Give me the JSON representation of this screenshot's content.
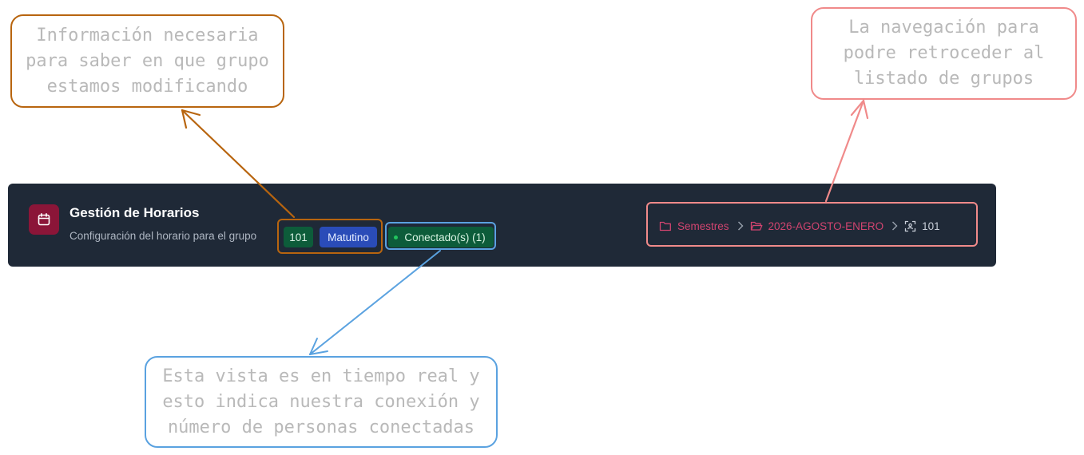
{
  "header": {
    "title": "Gestión de Horarios",
    "subtitle": "Configuración del horario para el grupo",
    "group_badge": "101",
    "shift_badge": "Matutino",
    "connection_badge": "Conectado(s) (1)"
  },
  "breadcrumb": {
    "items": [
      {
        "label": "Semestres",
        "icon": "folder-icon"
      },
      {
        "label": "2026-AGOSTO-ENERO",
        "icon": "folder-open-icon"
      },
      {
        "label": "101",
        "icon": "group-scan-icon"
      }
    ]
  },
  "annotations": {
    "group_info": [
      "Información necesaria",
      "para saber en que grupo",
      "estamos modificando"
    ],
    "navigation": [
      "La navegación para",
      "podre retroceder al",
      "listado de grupos"
    ],
    "connection": [
      "Esta vista es en tiempo real y",
      "esto indica nuestra conexión y",
      "número de personas conectadas"
    ]
  },
  "colors": {
    "header_bg": "#1f2937",
    "accent": "#8b1538",
    "breadcrumb_link": "#d0446f",
    "badge_green": "#0d5c3a",
    "badge_blue": "#2a4cb8",
    "annotation_orange": "#b8650f",
    "annotation_pink": "#f08a8a",
    "annotation_blue": "#5aa2e0"
  }
}
